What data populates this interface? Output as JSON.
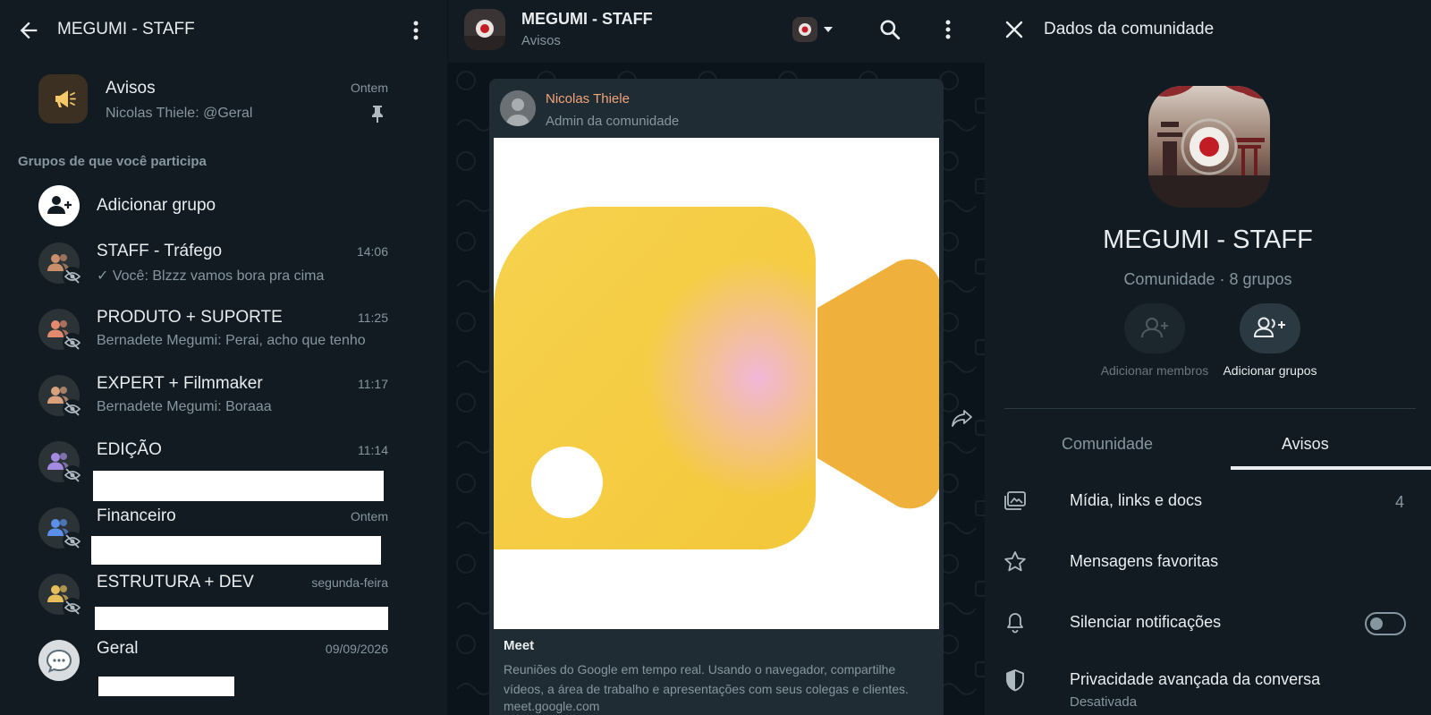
{
  "left": {
    "title": "MEGUMI - STAFF",
    "pinned": {
      "name": "Avisos",
      "preview": "Nicolas Thiele: @Geral",
      "time": "Ontem"
    },
    "section_label": "Grupos de que você participa",
    "add_group_label": "Adicionar grupo",
    "chats": [
      {
        "name": "STAFF - Tráfego",
        "time": "14:06",
        "preview": "Você: Blzzz vamos bora pra cima",
        "color": "#c98f6a"
      },
      {
        "name": "PRODUTO + SUPORTE",
        "time": "11:25",
        "preview": "Bernadete Megumi: Perai, acho que tenho",
        "color": "#e3896d"
      },
      {
        "name": "EXPERT + Filmmaker",
        "time": "11:17",
        "preview": "Bernadete Megumi: Boraaa",
        "color": "#d9a27c"
      },
      {
        "name": "EDIÇÃO",
        "time": "11:14",
        "preview": "",
        "color": "#a48be0"
      },
      {
        "name": "Financeiro",
        "time": "Ontem",
        "preview": "",
        "color": "#5b8fe8"
      },
      {
        "name": "ESTRUTURA + DEV",
        "time": "segunda-feira",
        "preview": "",
        "color": "#e6bf5a"
      },
      {
        "name": "Geral",
        "time": "09/09/2026",
        "preview": "",
        "color": "#d9dde0"
      }
    ]
  },
  "middle": {
    "title": "MEGUMI - STAFF",
    "subtitle": "Avisos",
    "message": {
      "sender": "Nicolas Thiele",
      "role": "Admin da comunidade",
      "link_title": "Meet",
      "link_desc": "Reuniões do Google em tempo real. Usando o navegador, compartilhe vídeos, a área de trabalho e apresentações com seus colegas e clientes.",
      "link_url": "meet.google.com"
    }
  },
  "right": {
    "header_title": "Dados da comunidade",
    "name": "MEGUMI - STAFF",
    "info": "Comunidade · 8 grupos",
    "actions": {
      "add_members": "Adicionar membros",
      "add_groups": "Adicionar grupos"
    },
    "tabs": {
      "community": "Comunidade",
      "notices": "Avisos"
    },
    "options": {
      "media": {
        "label": "Mídia, links e docs",
        "count": "4"
      },
      "starred": {
        "label": "Mensagens favoritas"
      },
      "mute": {
        "label": "Silenciar notificações"
      },
      "privacy": {
        "label": "Privacidade avançada da conversa",
        "sub": "Desativada"
      }
    }
  },
  "colors": {
    "panel": "#111b21",
    "chat_bg": "#0b141a",
    "bubble": "#202c33",
    "sender": "#f2a47a",
    "secondary_text": "#8696a0"
  }
}
